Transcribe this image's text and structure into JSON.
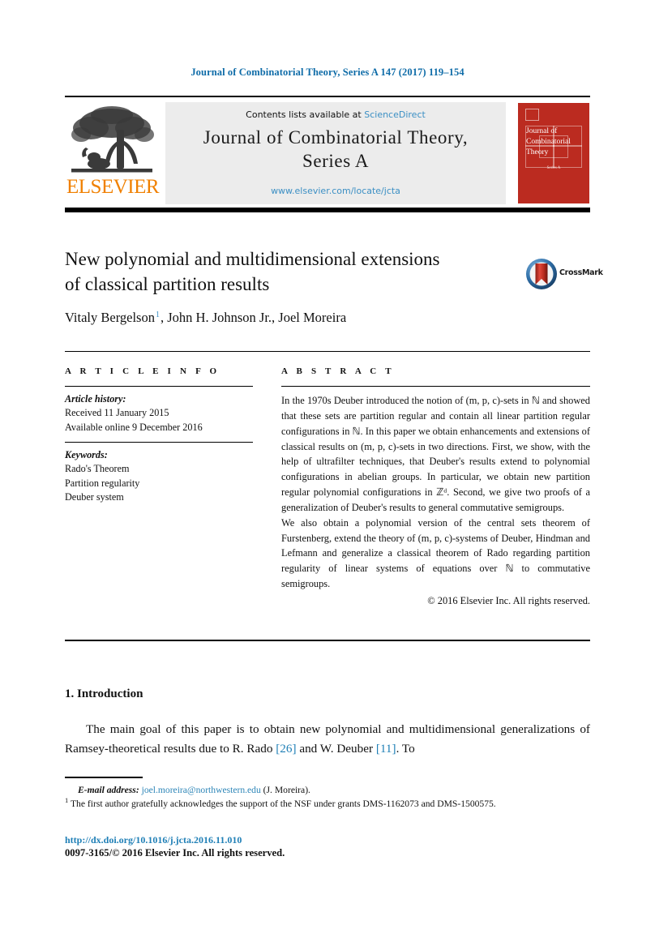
{
  "running_head": "Journal of Combinatorial Theory, Series A 147 (2017) 119–154",
  "masthead": {
    "contents_prefix": "Contents lists available at ",
    "contents_link": "ScienceDirect",
    "journal_title_line1": "Journal of Combinatorial Theory,",
    "journal_title_line2": "Series A",
    "journal_url": "www.elsevier.com/locate/jcta",
    "publisher_name": "ELSEVIER",
    "cover": {
      "title_line1": "Journal of",
      "title_line2": "Combinatorial",
      "title_line3": "Theory",
      "subtitle": "Series A"
    }
  },
  "article": {
    "title_line1": "New polynomial and multidimensional extensions",
    "title_line2": "of classical partition results",
    "authors_pre": "Vitaly Bergelson",
    "authors_footnote_marker": "1",
    "authors_post": ", John H. Johnson Jr., Joel Moreira",
    "crossmark_label": "CrossMark"
  },
  "info": {
    "heading": "A R T I C L E    I N F O",
    "history_label": "Article history:",
    "history_lines": [
      "Received 11 January 2015",
      "Available online 9 December 2016"
    ],
    "keywords_label": "Keywords:",
    "keywords": [
      "Rado's Theorem",
      "Partition regularity",
      "Deuber system"
    ]
  },
  "abstract": {
    "heading": "A B S T R A C T",
    "paragraph1": "In the 1970s Deuber introduced the notion of (m, p, c)-sets in ℕ and showed that these sets are partition regular and contain all linear partition regular configurations in ℕ. In this paper we obtain enhancements and extensions of classical results on (m, p, c)-sets in two directions. First, we show, with the help of ultrafilter techniques, that Deuber's results extend to polynomial configurations in abelian groups. In particular, we obtain new partition regular polynomial configurations in ℤᵈ. Second, we give two proofs of a generalization of Deuber's results to general commutative semigroups.",
    "paragraph2": "We also obtain a polynomial version of the central sets theorem of Furstenberg, extend the theory of (m, p, c)-systems of Deuber, Hindman and Lefmann and generalize a classical theorem of Rado regarding partition regularity of linear systems of equations over ℕ to commutative semigroups.",
    "copyright": "© 2016 Elsevier Inc. All rights reserved."
  },
  "body": {
    "section_title": "1.  Introduction",
    "paragraph_part1": "The main goal of this paper is to obtain new polynomial and multidimensional generalizations of Ramsey-theoretical results due to R. Rado ",
    "ref1": "[26]",
    "paragraph_part2": " and W. Deuber ",
    "ref2": "[11]",
    "paragraph_part3": ". To"
  },
  "footnotes": {
    "email_label": "E-mail address:",
    "email_link": "joel.moreira@northwestern.edu",
    "email_suffix": " (J. Moreira).",
    "marker": "1",
    "note_text": "The first author gratefully acknowledges the support of the NSF under grants DMS-1162073 and DMS-1500575."
  },
  "footer": {
    "doi": "http://dx.doi.org/10.1016/j.jcta.2016.11.010",
    "issn_line": "0097-3165/© 2016 Elsevier Inc. All rights reserved."
  },
  "colors": {
    "link_blue": "#3b8fc4",
    "header_blue": "#0f6ca8",
    "elsevier_orange": "#f08000",
    "cover_red": "#bb2b20"
  }
}
